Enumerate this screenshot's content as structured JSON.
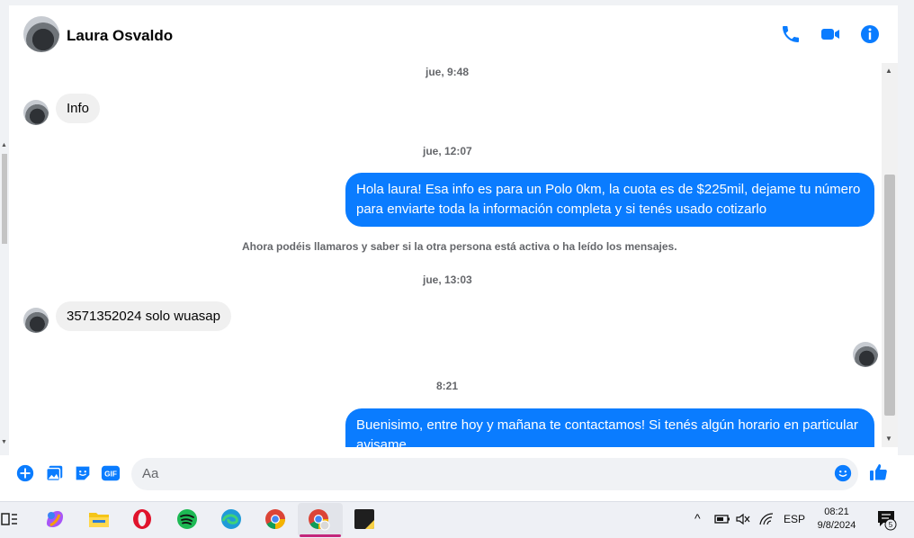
{
  "contact": {
    "name": "Laura Osvaldo"
  },
  "header_icons": [
    "phone-icon",
    "video-camera-icon",
    "info-icon"
  ],
  "messages": {
    "ts1": "jue, 9:48",
    "msg1": "Info",
    "ts2": "jue, 12:07",
    "msg2_line1": "Hola laura! Esa info es para un Polo 0km, la cuota es de $225mil, dejame tu número",
    "msg2_line2": "para enviarte toda la información completa y si tenés usado cotizarlo",
    "notice": "Ahora podéis llamaros y saber si la otra persona está activa o ha leído los mensajes.",
    "ts3": "jue, 13:03",
    "msg3": "3571352024 solo wuasap",
    "ts4": "8:21",
    "msg4_line1": "Buenisimo, entre hoy y mañana te contactamos! Si tenés algún horario en particular",
    "msg4_line2": "avisame"
  },
  "composer": {
    "placeholder": "Aa"
  },
  "taskbar": {
    "language": "ESP",
    "time": "08:21",
    "date": "9/8/2024",
    "notification_count": "5"
  },
  "colors": {
    "accent": "#0a7cff",
    "incoming_bubble": "#f0f0f0"
  }
}
